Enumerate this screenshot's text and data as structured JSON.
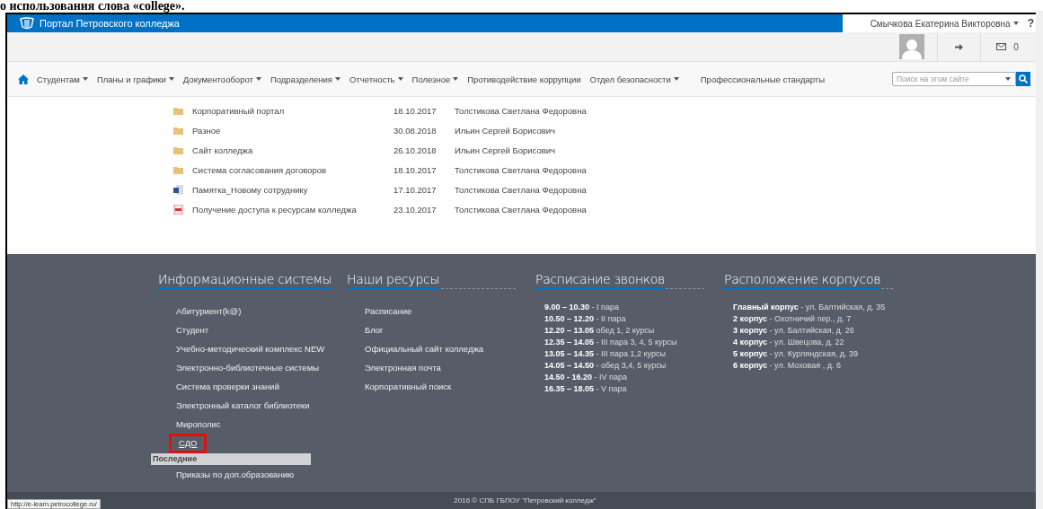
{
  "heading": "о использования слова «college».",
  "portal": {
    "title": "Портал Петровского колледжа",
    "user": "Смычкова Екатерина Викторовна",
    "help": "?",
    "mail_count": "0"
  },
  "nav": [
    {
      "label": "Студентам",
      "has_menu": true
    },
    {
      "label": "Планы и графики",
      "has_menu": true
    },
    {
      "label": "Документооборот",
      "has_menu": true
    },
    {
      "label": "Подразделения",
      "has_menu": true
    },
    {
      "label": "Отчетность",
      "has_menu": true
    },
    {
      "label": "Полезное",
      "has_menu": true
    },
    {
      "label": "Противодействие коррупции",
      "has_menu": false
    },
    {
      "label": "Отдел безопасности",
      "has_menu": true
    },
    {
      "label": "Профессиональные стандарты",
      "has_menu": false
    }
  ],
  "search": {
    "placeholder": "Поиск на этом сайте"
  },
  "files": [
    {
      "kind": "folder",
      "name": "Корпоративный портал",
      "date": "18.10.2017",
      "author": "Толстикова Светлана Федоровна"
    },
    {
      "kind": "folder",
      "name": "Разное",
      "date": "30.08.2018",
      "author": "Ильин Сергей Борисович"
    },
    {
      "kind": "folder",
      "name": "Сайт колледжа",
      "date": "26.10.2018",
      "author": "Ильин Сергей Борисович"
    },
    {
      "kind": "folder",
      "name": "Система согласования договоров",
      "date": "18.10.2017",
      "author": "Толстикова Светлана Федоровна"
    },
    {
      "kind": "doc",
      "name": "Памятка_Новому сотруднику",
      "date": "17.10.2017",
      "author": "Толстикова Светлана Федоровна"
    },
    {
      "kind": "pdf",
      "name": "Получение доступа к ресурсам колледжа",
      "date": "23.10.2017",
      "author": "Толстикова Светлана Федоровна"
    }
  ],
  "footer": {
    "columns": [
      {
        "title": "Информационные системы",
        "kind": "links",
        "items": [
          {
            "text": "Абитуриент(k@)",
            "highlighted": false
          },
          {
            "text": "Студент",
            "highlighted": false
          },
          {
            "text": "Учебно-методический комплекс NEW",
            "highlighted": false
          },
          {
            "text": "Электронно-библиотечные системы",
            "highlighted": false
          },
          {
            "text": "Система проверки знаний",
            "highlighted": false
          },
          {
            "text": "Электронный каталог библиотеки",
            "highlighted": false
          },
          {
            "text": "Мирополис",
            "highlighted": false
          },
          {
            "text": "СДО",
            "highlighted": true
          }
        ],
        "recent_title": "Последние",
        "recent": [
          "Приказы по доп.образованию"
        ]
      },
      {
        "title": "Наши ресурсы",
        "kind": "links",
        "items": [
          {
            "text": "Расписание",
            "highlighted": false
          },
          {
            "text": "Блог",
            "highlighted": false
          },
          {
            "text": "Официальный сайт колледжа",
            "highlighted": false
          },
          {
            "text": "Электронная почта",
            "highlighted": false
          },
          {
            "text": "Корпоративный поиск",
            "highlighted": false
          }
        ]
      },
      {
        "title": "Расписание звонков",
        "kind": "lines",
        "lines": [
          "**9.00 – 10.30** - I пара",
          "**10.50 – 12.20** - II пара",
          "**12.20 – 13.05** обед 1, 2 курсы",
          "**12.35 – 14.05** - III пара 3, 4, 5 курсы",
          "**13.05 – 14.35** - III пара 1,2 курсы",
          "**14.05 – 14.50** - обед 3,4, 5 курсы",
          "**14.50 - 16.20** - IV пара",
          "**16.35 – 18.05** - V пара"
        ]
      },
      {
        "title": "Расположение корпусов",
        "kind": "lines",
        "lines": [
          "**Главный корпус** - ул. Балтийская, д. 35",
          "**2 корпус** - Охотничий пер., д. 7",
          "**3 корпус** - ул. Балтийская, д. 26",
          "**4 корпус** - ул. Швецова, д. 22",
          "**5 корпус** - ул. Курляндская, д. 39",
          "**6 корпус** - ул. Моховая , д. 6"
        ]
      }
    ],
    "copyright": "2016 © СПБ ГБПОУ \"Петровский колледж\""
  },
  "status_url": "http://e-learn.petrocollege.ru/"
}
